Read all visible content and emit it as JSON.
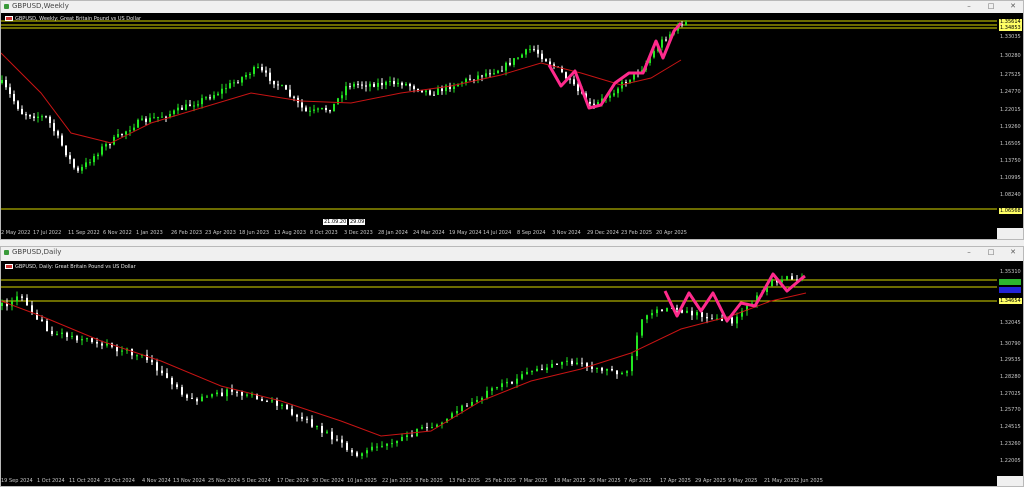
{
  "colors": {
    "background": "#000000",
    "bull": "#22e622",
    "bear": "#ffffff",
    "ma": "#c81414",
    "trend": "#ff2a8c",
    "hline": "#d8d800",
    "axis_text": "#c8c8c8"
  },
  "weekly": {
    "window_title": "GBPUSD,Weekly",
    "chart_label": "GBPUSD, Weekly: Great Britain Pound vs US Dollar",
    "y_ticks": [
      "1.33035",
      "1.30280",
      "1.27525",
      "1.24770",
      "1.22015",
      "1.19260",
      "1.16505",
      "1.13750",
      "1.10995",
      "1.08240"
    ],
    "x_ticks": [
      "2 May 2022",
      "17 Jul 2022",
      "11 Sep 2022",
      "6 Nov 2022",
      "1 Jan 2023",
      "26 Feb 2023",
      "23 Apr 2023",
      "18 Jun 2023",
      "13 Aug 2023",
      "8 Oct 2023",
      "3 Dec 2023",
      "28 Jan 2024",
      "24 Mar 2024",
      "19 May 2024",
      "14 Jul 2024",
      "8 Sep 2024",
      "3 Nov 2024",
      "29 Dec 2024",
      "23 Feb 2025",
      "20 Apr 2025"
    ],
    "price_labels": [
      "1.35614",
      "1.34853",
      "1.06568"
    ],
    "date_tags": [
      "21.09.20",
      "29.09"
    ],
    "controls": [
      "minimize-icon",
      "maximize-icon",
      "close-icon"
    ]
  },
  "daily": {
    "window_title": "GBPUSD,Daily",
    "chart_label": "GBPUSD, Daily: Great Britain Pound vs US Dollar",
    "y_ticks": [
      "1.35310",
      "1.32045",
      "1.30790",
      "1.29535",
      "1.28280",
      "1.27025",
      "1.25770",
      "1.24515",
      "1.23260",
      "1.22005"
    ],
    "x_ticks": [
      "19 Sep 2024",
      "1 Oct 2024",
      "11 Oct 2024",
      "23 Oct 2024",
      "4 Nov 2024",
      "13 Nov 2024",
      "25 Nov 2024",
      "5 Dec 2024",
      "17 Dec 2024",
      "30 Dec 2024",
      "10 Jan 2025",
      "22 Jan 2025",
      "3 Feb 2025",
      "13 Feb 2025",
      "25 Feb 2025",
      "7 Mar 2025",
      "18 Mar 2025",
      "26 Mar 2025",
      "7 Apr 2025",
      "17 Apr 2025",
      "29 Apr 2025",
      "9 May 2025",
      "21 May 2025",
      "2 Jun 2025"
    ],
    "price_labels": [
      "1.34654"
    ],
    "controls": [
      "minimize-icon",
      "maximize-icon",
      "close-icon"
    ]
  }
}
